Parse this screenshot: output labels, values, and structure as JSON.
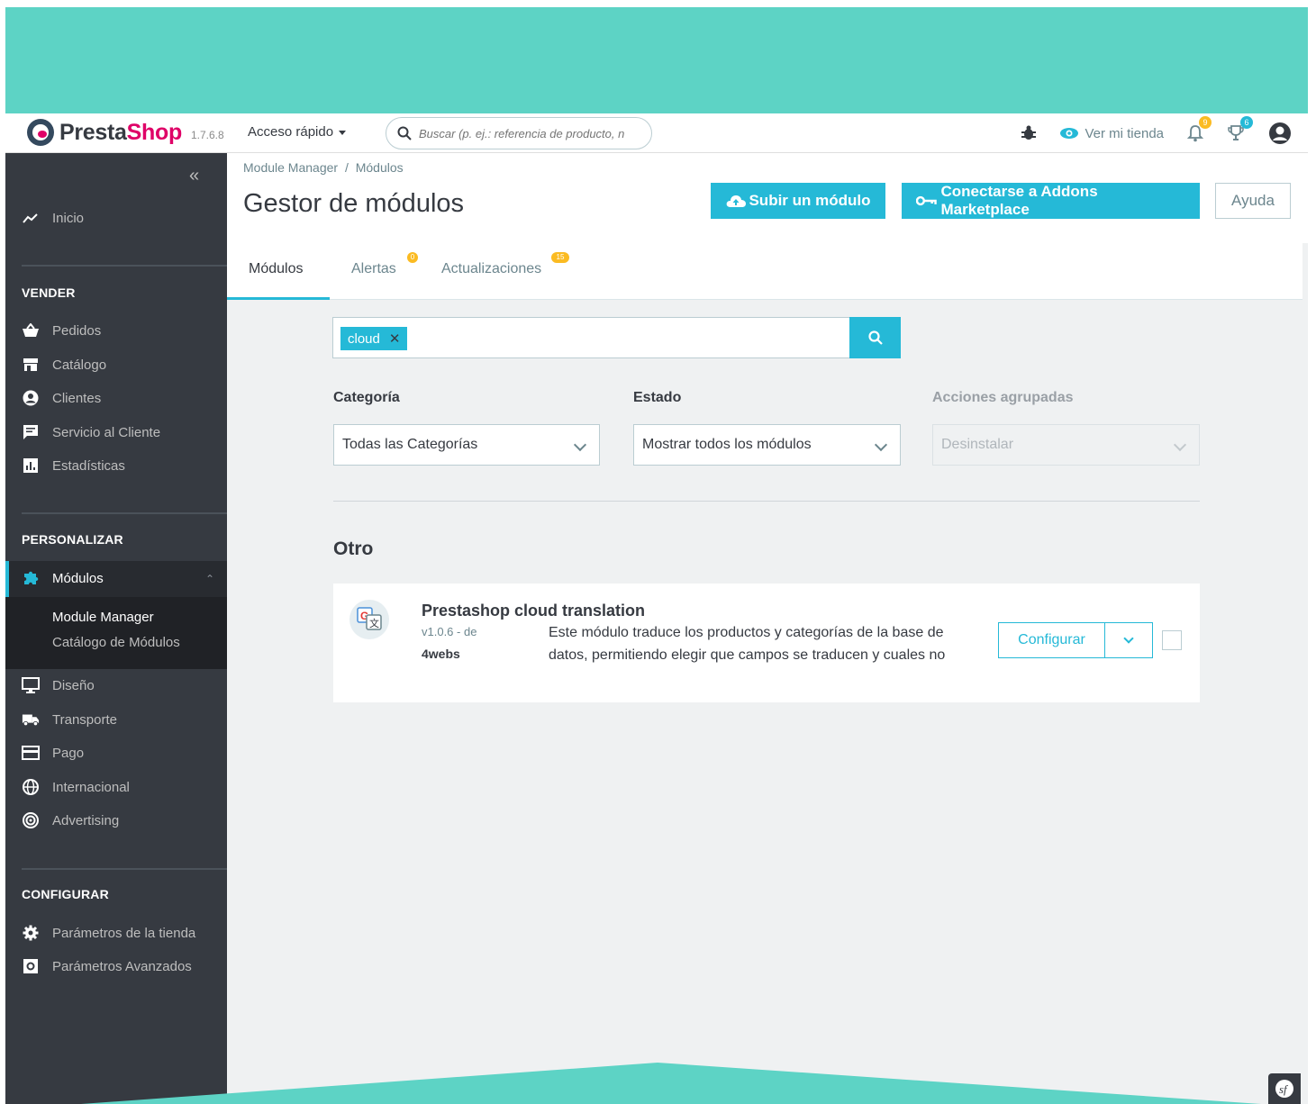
{
  "app": {
    "brand_presta": "Presta",
    "brand_shop": "Shop",
    "version": "1.7.6.8"
  },
  "header": {
    "quick_access": "Acceso rápido",
    "search_placeholder": "Buscar (p. ej.: referencia de producto, n",
    "view_store": "Ver mi tienda",
    "notif_badge": "9",
    "trophy_badge": "6"
  },
  "sidebar": {
    "home": "Inicio",
    "sell_title": "VENDER",
    "sell_items": [
      "Pedidos",
      "Catálogo",
      "Clientes",
      "Servicio al Cliente",
      "Estadísticas"
    ],
    "customize_title": "PERSONALIZAR",
    "modules": "Módulos",
    "module_sub": [
      "Module Manager",
      "Catálogo de Módulos"
    ],
    "customize_items": [
      "Diseño",
      "Transporte",
      "Pago",
      "Internacional",
      "Advertising"
    ],
    "config_title": "CONFIGURAR",
    "config_items": [
      "Parámetros de la tienda",
      "Parámetros Avanzados"
    ]
  },
  "page": {
    "breadcrumb_1": "Module Manager",
    "breadcrumb_sep": "/",
    "breadcrumb_2": "Módulos",
    "title": "Gestor de módulos",
    "upload_btn": "Subir un módulo",
    "connect_btn": "Conectarse a Addons Marketplace",
    "help_btn": "Ayuda"
  },
  "tabs": {
    "modules": "Módulos",
    "alerts": "Alertas",
    "alerts_badge": "0",
    "updates": "Actualizaciones",
    "updates_badge": "15"
  },
  "filters": {
    "search_tag": "cloud",
    "category_label": "Categoría",
    "category_value": "Todas las Categorías",
    "status_label": "Estado",
    "status_value": "Mostrar todos los módulos",
    "bulk_label": "Acciones agrupadas",
    "bulk_value": "Desinstalar"
  },
  "section": {
    "title": "Otro"
  },
  "module": {
    "name": "Prestashop cloud translation",
    "version": "v1.0.6 - de",
    "author": "4webs",
    "description": "Este módulo traduce los productos y categorías de la base de datos, permitiendo elegir que campos se traducen y cuales no",
    "configure": "Configurar"
  },
  "colors": {
    "accent": "#25b9d7",
    "sidebar": "#363a41",
    "teal_frame": "#5dd3c5",
    "brand_pink": "#df0067",
    "badge_orange": "#fbbb22"
  }
}
